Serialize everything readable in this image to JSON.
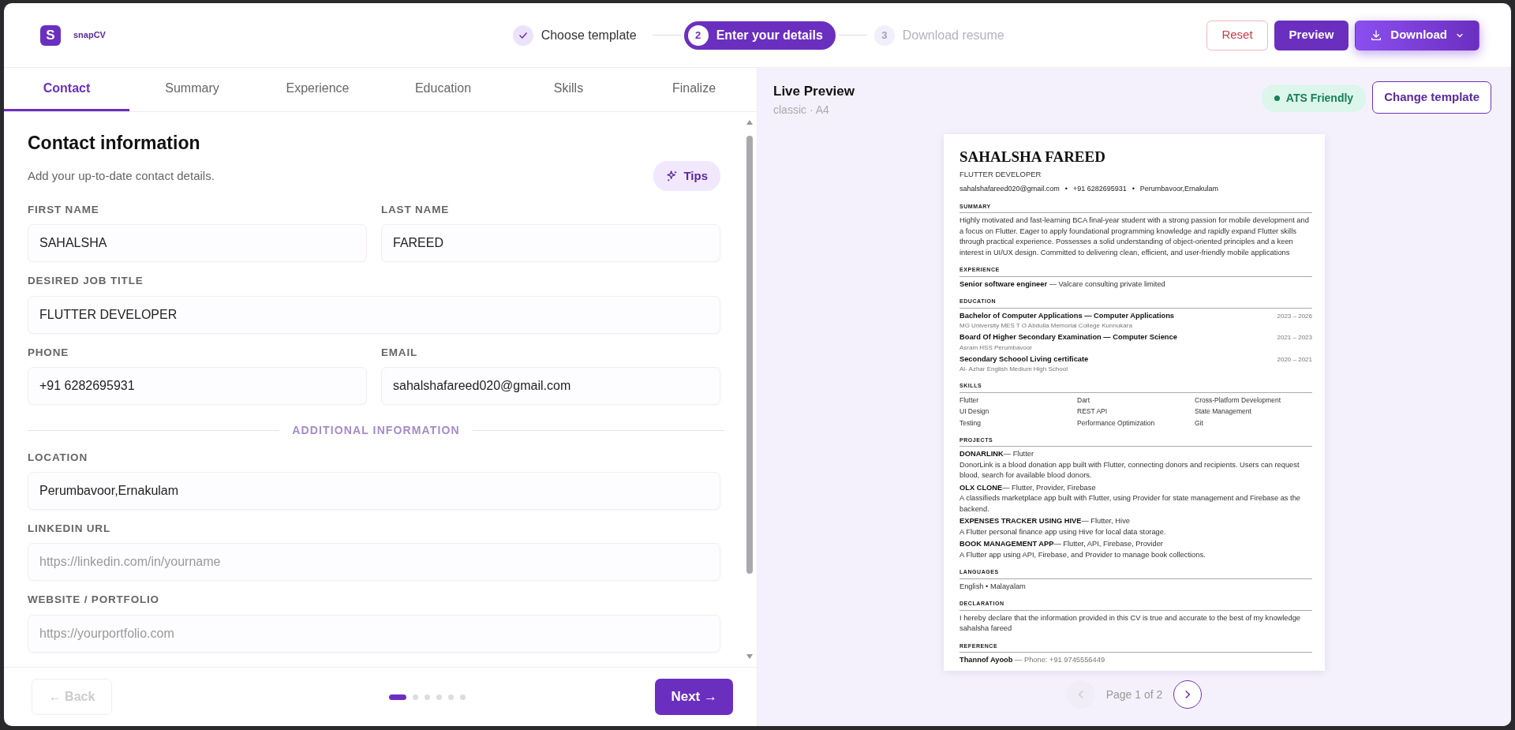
{
  "header": {
    "logo_letter": "S",
    "brand": "snapCV",
    "steps": [
      {
        "label": "Choose template",
        "completed": true,
        "selected": false
      },
      {
        "number": "2",
        "label": "Enter your details",
        "completed": false,
        "selected": true
      },
      {
        "number": "3",
        "label": "Download resume",
        "completed": false,
        "selected": false
      }
    ],
    "buttons": [
      {
        "label": "Reset",
        "kind": "outline"
      },
      {
        "label": "Preview",
        "kind": "primary"
      },
      {
        "label": "Download",
        "kind": "menu"
      }
    ]
  },
  "tabs": [
    {
      "label": "Contact",
      "selected": true
    },
    {
      "label": "Summary",
      "selected": false
    },
    {
      "label": "Experience",
      "selected": false
    },
    {
      "label": "Education",
      "selected": false
    },
    {
      "label": "Skills",
      "selected": false
    },
    {
      "label": "Finalize",
      "selected": false
    }
  ],
  "form": {
    "title": "Contact information",
    "subtitle": "Add your up-to-date contact details.",
    "tips": "Tips",
    "items": [
      {
        "kind": "row",
        "fields": [
          {
            "label": "FIRST NAME",
            "value": "SAHALSHA"
          },
          {
            "label": "LAST NAME",
            "value": "FAREED"
          }
        ]
      },
      {
        "kind": "row",
        "fields": [
          {
            "label": "DESIRED JOB TITLE",
            "value": "FLUTTER DEVELOPER"
          }
        ]
      },
      {
        "kind": "row",
        "fields": [
          {
            "label": "PHONE",
            "value": "+91 6282695931"
          },
          {
            "label": "EMAIL",
            "value": "sahalshafareed020@gmail.com"
          }
        ]
      },
      {
        "kind": "divider",
        "text": "ADDITIONAL INFORMATION"
      },
      {
        "kind": "row",
        "fields": [
          {
            "label": "LOCATION",
            "value": "Perumbavoor,Ernakulam"
          }
        ]
      },
      {
        "kind": "row",
        "fields": [
          {
            "label": "LINKEDIN URL",
            "placeholder": "https://linkedin.com/in/yourname"
          }
        ]
      },
      {
        "kind": "row",
        "fields": [
          {
            "label": "WEBSITE / PORTFOLIO",
            "placeholder": "https://yourportfolio.com"
          }
        ]
      }
    ]
  },
  "footer": {
    "back": {
      "label": "← Back",
      "disabled": true
    },
    "dots": [
      {
        "selected": true
      },
      {
        "selected": false
      },
      {
        "selected": false
      },
      {
        "selected": false
      },
      {
        "selected": false
      },
      {
        "selected": false
      }
    ],
    "next": {
      "label": "Next →"
    }
  },
  "preview": {
    "title": "Live Preview",
    "subtitle": "classic · A4",
    "badge": "ATS Friendly",
    "change_button": "Change template",
    "resume": {
      "name": "SAHALSHA FAREED",
      "job_title": "FLUTTER DEVELOPER",
      "contact_separator": "•",
      "contacts": [
        "sahalshafareed020@gmail.com",
        "+91 6282695931",
        "Perumbavoor,Ernakulam"
      ],
      "sections": [
        {
          "heading": "SUMMARY",
          "kind": "text",
          "text": "Highly motivated and fast-learning BCA final-year student with a strong passion for mobile development and a focus on Flutter. Eager to apply foundational programming knowledge and rapidly expand Flutter skills through practical experience. Possesses a solid understanding of object-oriented principles and a keen interest in UI/UX design. Committed to delivering clean, efficient, and user-friendly mobile applications"
        },
        {
          "heading": "EXPERIENCE",
          "kind": "entries",
          "entries": [
            {
              "title": "Senior software engineer",
              "detail": " — Valcare consulting private limited"
            }
          ]
        },
        {
          "heading": "EDUCATION",
          "kind": "dated",
          "entries": [
            {
              "title": "Bachelor of Computer Applications — Computer Applications",
              "dates": "2023 – 2026",
              "sub": "MG University MES T O Abdulla Memorial College Kunnukara"
            },
            {
              "title": "Board Of Higher Secondary Examination — Computer Science",
              "dates": "2021 – 2023",
              "sub": "Asram HSS Perumbavoor"
            },
            {
              "title": "Secondary Schoool Living certificate",
              "dates": "2020 – 2021",
              "sub": "Al- Azhar English Medium High School"
            }
          ]
        },
        {
          "heading": "SKILLS",
          "kind": "grid",
          "items": [
            "Flutter",
            "Dart",
            "Cross-Platform Development",
            "UI Design",
            "REST API",
            "State Management",
            "Testing",
            "Performance Optimization",
            "Git"
          ]
        },
        {
          "heading": "PROJECTS",
          "kind": "projects",
          "entries": [
            {
              "title": "DONARLINK",
              "detail": "— Flutter",
              "text": "DonorLink is a blood donation app built with Flutter, connecting donors and recipients. Users can request blood, search for available blood donors."
            },
            {
              "title": "OLX CLONE",
              "detail": "— Flutter, Provider, Firebase",
              "text": "A classifieds marketplace app built with Flutter, using Provider for state management and Firebase as the backend."
            },
            {
              "title": "EXPENSES TRACKER USING HIVE",
              "detail": "— Flutter, Hive",
              "text": "A Flutter personal finance app using Hive for local data storage."
            },
            {
              "title": "BOOK MANAGEMENT APP",
              "detail": "— Flutter, API, Firebase, Provider",
              "text": "A Flutter app using API, Firebase, and Provider to manage book collections."
            }
          ]
        },
        {
          "heading": "LANGUAGES",
          "kind": "text",
          "text": "English • Malayalam"
        },
        {
          "heading": "DECLARATION",
          "kind": "text",
          "text": "I hereby declare that the information provided in this CV is true and accurate to the best of my knowledge sahalsha fareed"
        },
        {
          "heading": "REFERENCE",
          "kind": "entries",
          "entries": [
            {
              "title": "Thannof Ayoob",
              "detail": " — Phone: +91 9745556449",
              "muted": true
            }
          ]
        }
      ]
    },
    "pager": {
      "text": "Page 1 of 2",
      "prev_disabled": true,
      "next_disabled": false
    }
  }
}
